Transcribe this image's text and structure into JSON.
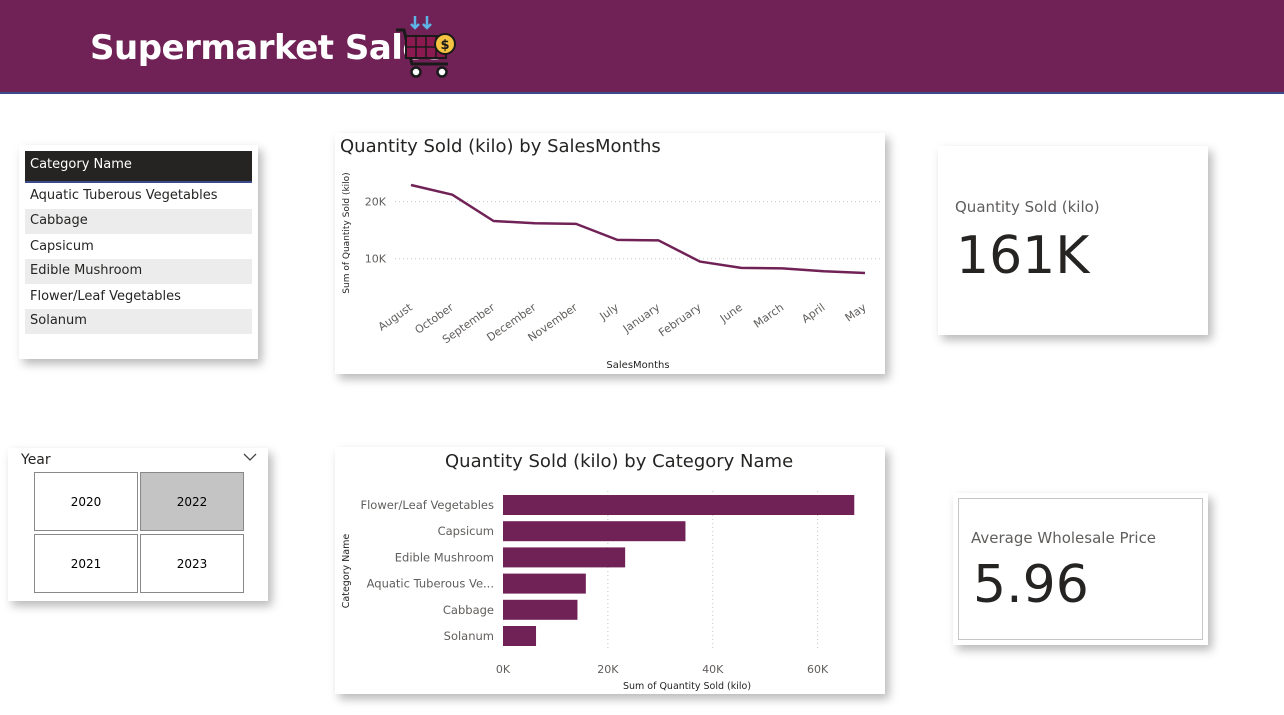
{
  "header": {
    "title": "Supermarket Sales",
    "background_color": "#702256",
    "logo_icon": "shopping-cart-dollar-icon"
  },
  "category_slicer": {
    "header": "Category Name",
    "items": [
      "Aquatic Tuberous Vegetables",
      "Cabbage",
      "Capsicum",
      "Edible Mushroom",
      "Flower/Leaf Vegetables",
      "Solanum"
    ]
  },
  "year_slicer": {
    "label": "Year",
    "dropdown_icon": "chevron-down-icon",
    "options": [
      "2020",
      "2022",
      "2021",
      "2023"
    ],
    "selected": "2022"
  },
  "kpis": {
    "quantity": {
      "label": "Quantity Sold (kilo)",
      "value": "161K"
    },
    "price": {
      "label": "Average Wholesale Price",
      "value": "5.96"
    }
  },
  "chart_data": [
    {
      "type": "line",
      "title": "Quantity Sold (kilo) by SalesMonths",
      "xlabel": "SalesMonths",
      "ylabel": "Sum of Quantity Sold (kilo)",
      "categories": [
        "August",
        "October",
        "September",
        "December",
        "November",
        "July",
        "January",
        "February",
        "June",
        "March",
        "April",
        "May"
      ],
      "values": [
        22900,
        21200,
        16600,
        16200,
        16100,
        13300,
        13200,
        9500,
        8400,
        8300,
        7800,
        7500
      ],
      "yticks": [
        10000,
        20000
      ],
      "ytick_labels": [
        "10K",
        "20K"
      ],
      "ylim": [
        4000,
        25000
      ],
      "grid": true,
      "color": "#702256"
    },
    {
      "type": "bar",
      "orientation": "horizontal",
      "title": "Quantity Sold (kilo) by Category Name",
      "xlabel": "Sum of Quantity Sold (kilo)",
      "ylabel": "Category Name",
      "categories": [
        "Flower/Leaf Vegetables",
        "Capsicum",
        "Edible Mushroom",
        "Aquatic Tuberous Ve...",
        "Cabbage",
        "Solanum"
      ],
      "values": [
        67000,
        34800,
        23300,
        15800,
        14200,
        6300
      ],
      "xticks": [
        0,
        20000,
        40000,
        60000
      ],
      "xtick_labels": [
        "0K",
        "20K",
        "40K",
        "60K"
      ],
      "xlim": [
        0,
        70000
      ],
      "grid": true,
      "color": "#702256"
    }
  ]
}
